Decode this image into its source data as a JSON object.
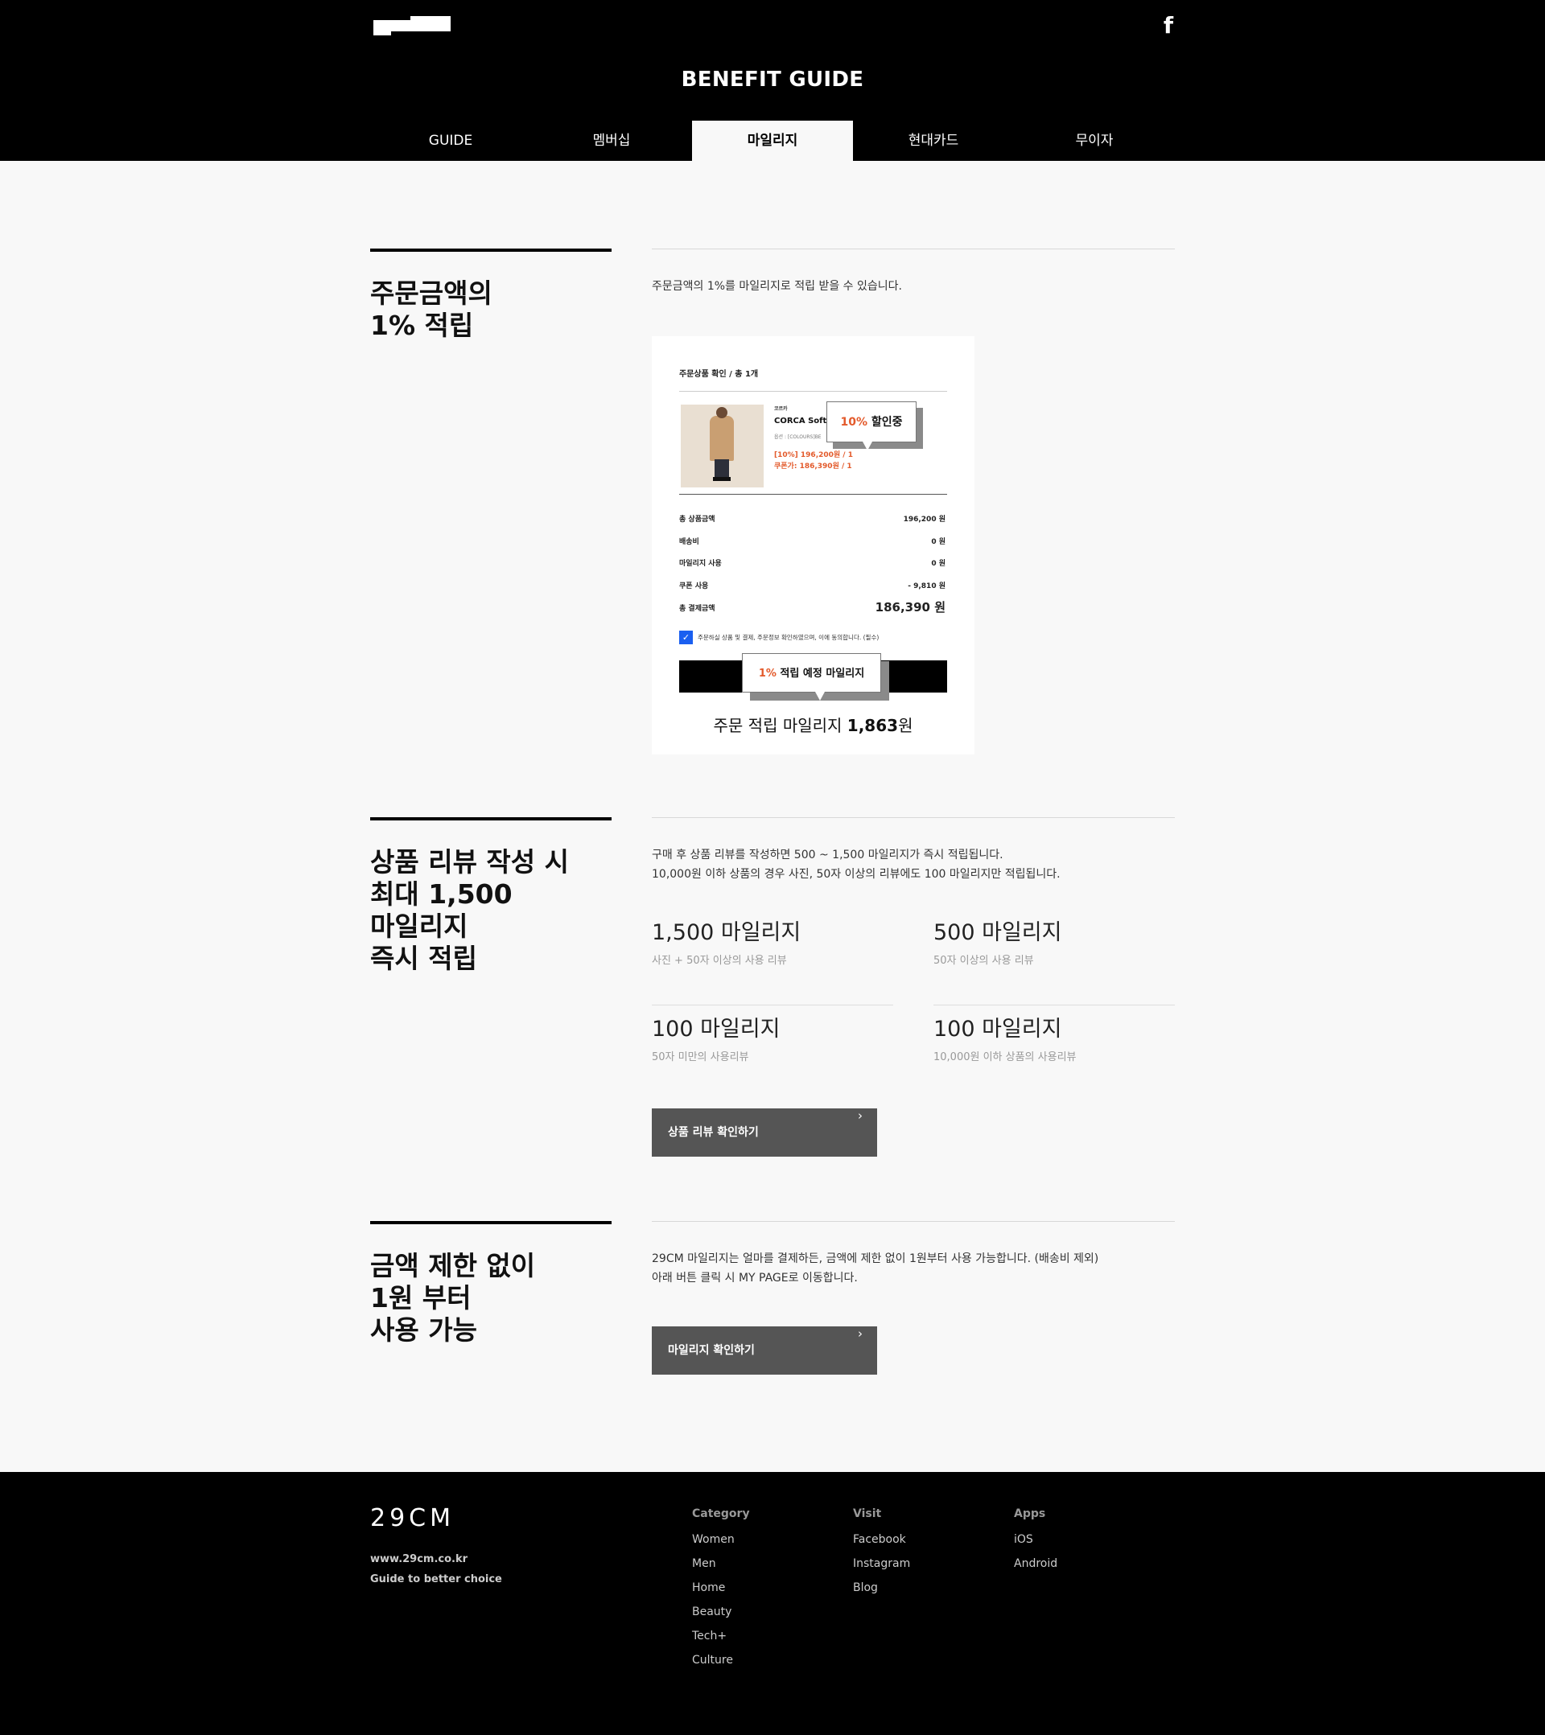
{
  "header": {
    "title": "BENEFIT GUIDE",
    "tabs": [
      {
        "label": "GUIDE",
        "active": false
      },
      {
        "label": "멤버십",
        "active": false
      },
      {
        "label": "마일리지",
        "active": true
      },
      {
        "label": "현대카드",
        "active": false
      },
      {
        "label": "무이자",
        "active": false
      }
    ]
  },
  "section1": {
    "title_lines": [
      "주문금액의",
      "1% 적립"
    ],
    "desc": "주문금액의 1%를 마일리지로 적립 받을 수 있습니다.",
    "receipt": {
      "header": "주문상품 확인 / 총 1개",
      "brand": "코르카",
      "product_name": "CORCA Soft",
      "option": "옵션 : [COLOURS]BE",
      "price_line1": "[10%] 196,200원 / 1",
      "price_line2": "쿠폰가: 186,390원 / 1",
      "discount_callout_hl": "10%",
      "discount_callout_text": " 할인중",
      "rows": [
        {
          "label": "총 상품금액",
          "value": "196,200 원"
        },
        {
          "label": "배송비",
          "value": "0 원"
        },
        {
          "label": "마일리지 사용",
          "value": "0 원"
        },
        {
          "label": "쿠폰 사용",
          "value": "- 9,810 원"
        },
        {
          "label": "총 결제금액",
          "value": "186,390 원"
        }
      ],
      "agree_text": "주문하실 상품 및 결제, 주문정보 확인하였으며, 이에 동의합니다. (필수)",
      "earn_callout_hl": "1%",
      "earn_callout_text": " 적립 예정 마일리지",
      "earn_prefix": "주문 적립 마일리지 ",
      "earn_amount": "1,863",
      "earn_suffix": "원"
    }
  },
  "section2": {
    "title_lines": [
      "상품 리뷰 작성 시",
      "최대 1,500",
      "마일리지",
      "즉시 적립"
    ],
    "desc_lines": [
      "구매 후 상품 리뷰를 작성하면 500 ~ 1,500 마일리지가 즉시 적립됩니다.",
      "10,000원 이하 상품의 경우 사진, 50자 이상의 리뷰에도 100 마일리지만 적립됩니다."
    ],
    "mileage_items": [
      {
        "amount": "1,500 마일리지",
        "condition": "사진 + 50자 이상의 사용 리뷰"
      },
      {
        "amount": "500 마일리지",
        "condition": "50자 이상의 사용 리뷰"
      },
      {
        "amount": "100 마일리지",
        "condition": "50자 미만의 사용리뷰"
      },
      {
        "amount": "100 마일리지",
        "condition": "10,000원 이하 상품의 사용리뷰"
      }
    ],
    "button_label": "상품 리뷰 확인하기"
  },
  "section3": {
    "title_lines": [
      "금액 제한 없이",
      "1원 부터",
      "사용 가능"
    ],
    "desc_lines": [
      "29CM 마일리지는 얼마를 결제하든, 금액에 제한 없이 1원부터 사용 가능합니다. (배송비 제외)",
      "아래 버튼 클릭 시 MY PAGE로 이동합니다."
    ],
    "button_label": "마일리지 확인하기"
  },
  "footer": {
    "logo": "29CM",
    "url": "www.29cm.co.kr",
    "tagline": "Guide to better choice",
    "columns": [
      {
        "heading": "Category",
        "items": [
          "Women",
          "Men",
          "Home",
          "Beauty",
          "Tech+",
          "Culture"
        ]
      },
      {
        "heading": "Visit",
        "items": [
          "Facebook",
          "Instagram",
          "Blog"
        ]
      },
      {
        "heading": "Apps",
        "items": [
          "iOS",
          "Android"
        ]
      }
    ]
  },
  "icons": {
    "facebook": "facebook-icon",
    "chevron": "chevron-right-icon",
    "check": "checkmark-icon"
  },
  "colors": {
    "accent_orange": "#e35a2b",
    "checkbox_blue": "#1a5ff0",
    "button_gray": "#555555"
  }
}
